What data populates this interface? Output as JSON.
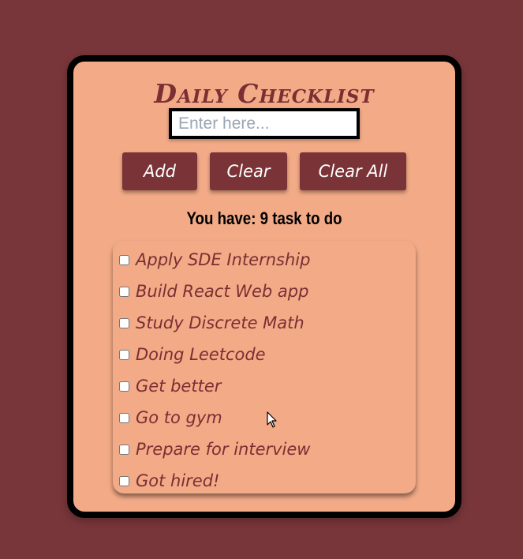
{
  "app": {
    "title": "Daily Checklist"
  },
  "input": {
    "placeholder": "Enter here...",
    "value": ""
  },
  "buttons": {
    "add": "Add",
    "clear": "Clear",
    "clear_all": "Clear All"
  },
  "status": {
    "count_text": "You have: 9 task to do"
  },
  "tasks": [
    {
      "label": "Apply SDE Internship",
      "checked": false
    },
    {
      "label": "Build React Web app",
      "checked": false
    },
    {
      "label": "Study Discrete Math",
      "checked": false
    },
    {
      "label": "Doing Leetcode",
      "checked": false
    },
    {
      "label": "Get better",
      "checked": false
    },
    {
      "label": "Go to gym",
      "checked": false
    },
    {
      "label": "Prepare for interview",
      "checked": false
    },
    {
      "label": "Got hired!",
      "checked": false
    }
  ],
  "colors": {
    "background": "#78363a",
    "card": "#f2aa87",
    "accent": "#7a3438",
    "title": "#7a2f33"
  }
}
